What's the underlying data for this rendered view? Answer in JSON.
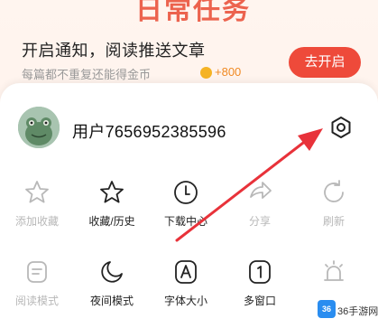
{
  "background": {
    "title": "日常任务",
    "row_title": "开启通知，阅读推送文章",
    "row_sub": "每篇都不重复还能得金币",
    "reward": "+800",
    "button": "去开启"
  },
  "user": {
    "name": "用户7656952385596"
  },
  "grid": {
    "row1": [
      {
        "label": "添加收藏",
        "icon": "star-outline-icon",
        "enabled": false
      },
      {
        "label": "收藏/历史",
        "icon": "star-outline-icon",
        "enabled": true
      },
      {
        "label": "下载中心",
        "icon": "download-clock-icon",
        "enabled": true
      },
      {
        "label": "分享",
        "icon": "share-icon",
        "enabled": false
      },
      {
        "label": "刷新",
        "icon": "refresh-icon",
        "enabled": false
      }
    ],
    "row2": [
      {
        "label": "阅读模式",
        "icon": "reader-mode-icon",
        "enabled": false
      },
      {
        "label": "夜间模式",
        "icon": "moon-icon",
        "enabled": true
      },
      {
        "label": "字体大小",
        "icon": "font-size-icon",
        "enabled": true
      },
      {
        "label": "多窗口",
        "icon": "multi-window-icon",
        "enabled": true
      },
      {
        "label": "",
        "icon": "alarm-icon",
        "enabled": false
      }
    ]
  },
  "colors": {
    "arrow": "#e8323a",
    "accent": "#ee4a3a",
    "disabled": "#b8b8b8"
  },
  "watermark": {
    "badge": "36",
    "text": "36手游网"
  }
}
